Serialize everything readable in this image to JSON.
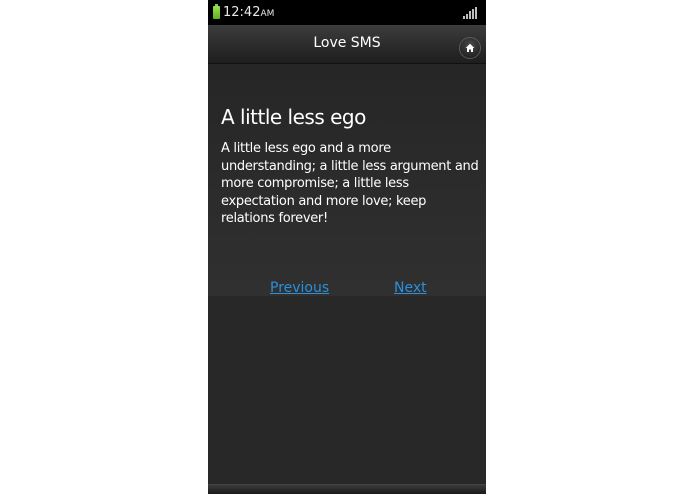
{
  "status_bar": {
    "time": "12:42",
    "ampm": "AM",
    "battery_icon": "battery-charging-icon",
    "signal_icon": "signal-bars-icon",
    "battery_color": "#7fd13a"
  },
  "header": {
    "title": "Love SMS",
    "home_icon": "home-icon"
  },
  "message": {
    "title": "A little less ego",
    "body": "A little less ego and a more understanding; a little less argument and more compromise; a little less expectation and more love; keep relations forever!"
  },
  "navigation": {
    "previous_label": "Previous",
    "next_label": "Next",
    "link_color": "#2b90d9"
  }
}
